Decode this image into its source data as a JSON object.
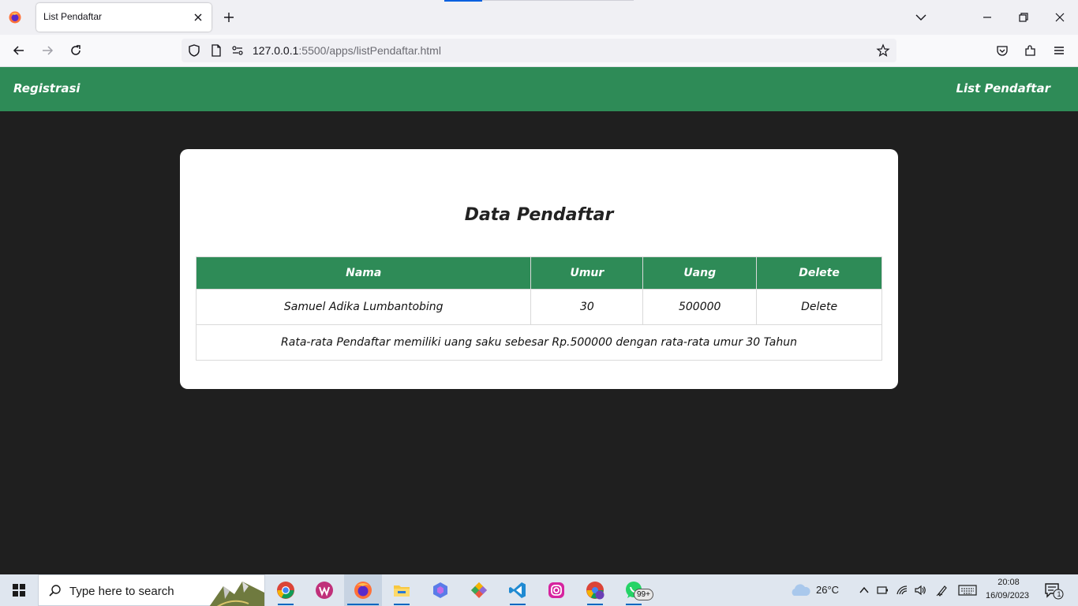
{
  "browser": {
    "tab_title": "List Pendaftar",
    "url_host": "127.0.0.1",
    "url_path": ":5500/apps/listPendaftar.html"
  },
  "site": {
    "brand": "Registrasi",
    "nav_link": "List Pendaftar",
    "accent_color": "#2e8b57"
  },
  "card": {
    "title": "Data Pendaftar"
  },
  "table": {
    "headers": [
      "Nama",
      "Umur",
      "Uang",
      "Delete"
    ],
    "rows": [
      {
        "nama": "Samuel Adika Lumbantobing",
        "umur": "30",
        "uang": "500000",
        "delete": "Delete"
      }
    ],
    "summary": "Rata-rata Pendaftar memiliki uang saku sebesar Rp.500000 dengan rata-rata umur 30 Tahun"
  },
  "taskbar": {
    "search_placeholder": "Type here to search",
    "whatsapp_badge": "99+",
    "weather": "26°C",
    "time": "20:08",
    "date": "16/09/2023",
    "notification_count": "1",
    "apps": [
      "chrome-icon",
      "wps-office-icon",
      "firefox-icon",
      "file-explorer-icon",
      "copilot-icon",
      "git-icon",
      "vscode-icon",
      "instagram-icon",
      "chrome-profile-icon",
      "whatsapp-icon"
    ]
  }
}
